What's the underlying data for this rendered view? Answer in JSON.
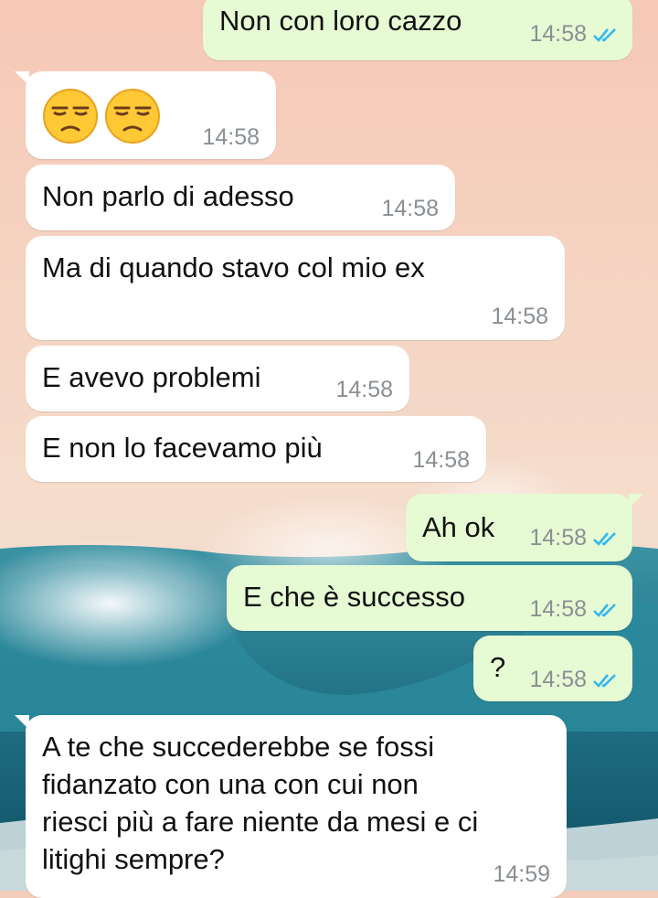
{
  "wallpaper": {
    "sky_color": "#f3cdb9",
    "sea_color": "#2a7f8f"
  },
  "messages": [
    {
      "dir": "out",
      "text": "Non con loro cazzo",
      "time": "14:58",
      "status": "read-double-tick-icon"
    },
    {
      "dir": "in",
      "emoji": [
        "unamused-face-emoji",
        "unamused-face-emoji"
      ],
      "time": "14:58"
    },
    {
      "dir": "in",
      "text": "Non parlo di adesso",
      "time": "14:58"
    },
    {
      "dir": "in",
      "text": "Ma di quando stavo col mio ex",
      "time": "14:58"
    },
    {
      "dir": "in",
      "text": "E avevo problemi",
      "time": "14:58"
    },
    {
      "dir": "in",
      "text": "E non lo facevamo più",
      "time": "14:58"
    },
    {
      "dir": "out",
      "text": "Ah ok",
      "time": "14:58",
      "status": "read-double-tick-icon"
    },
    {
      "dir": "out",
      "text": "E che è successo",
      "time": "14:58",
      "status": "read-double-tick-icon"
    },
    {
      "dir": "out",
      "text": "?",
      "time": "14:58",
      "status": "read-double-tick-icon"
    },
    {
      "dir": "in",
      "text": "A te che succederebbe se fossi\nfidanzato con una con cui non\nriesci più a fare niente da mesi e ci\nlitighi sempre?",
      "time": "14:59"
    }
  ],
  "colors": {
    "incoming": "#ffffff",
    "outgoing": "#e6fbd4",
    "read_tick": "#34b7f1",
    "timestamp": "#8a8f93"
  }
}
